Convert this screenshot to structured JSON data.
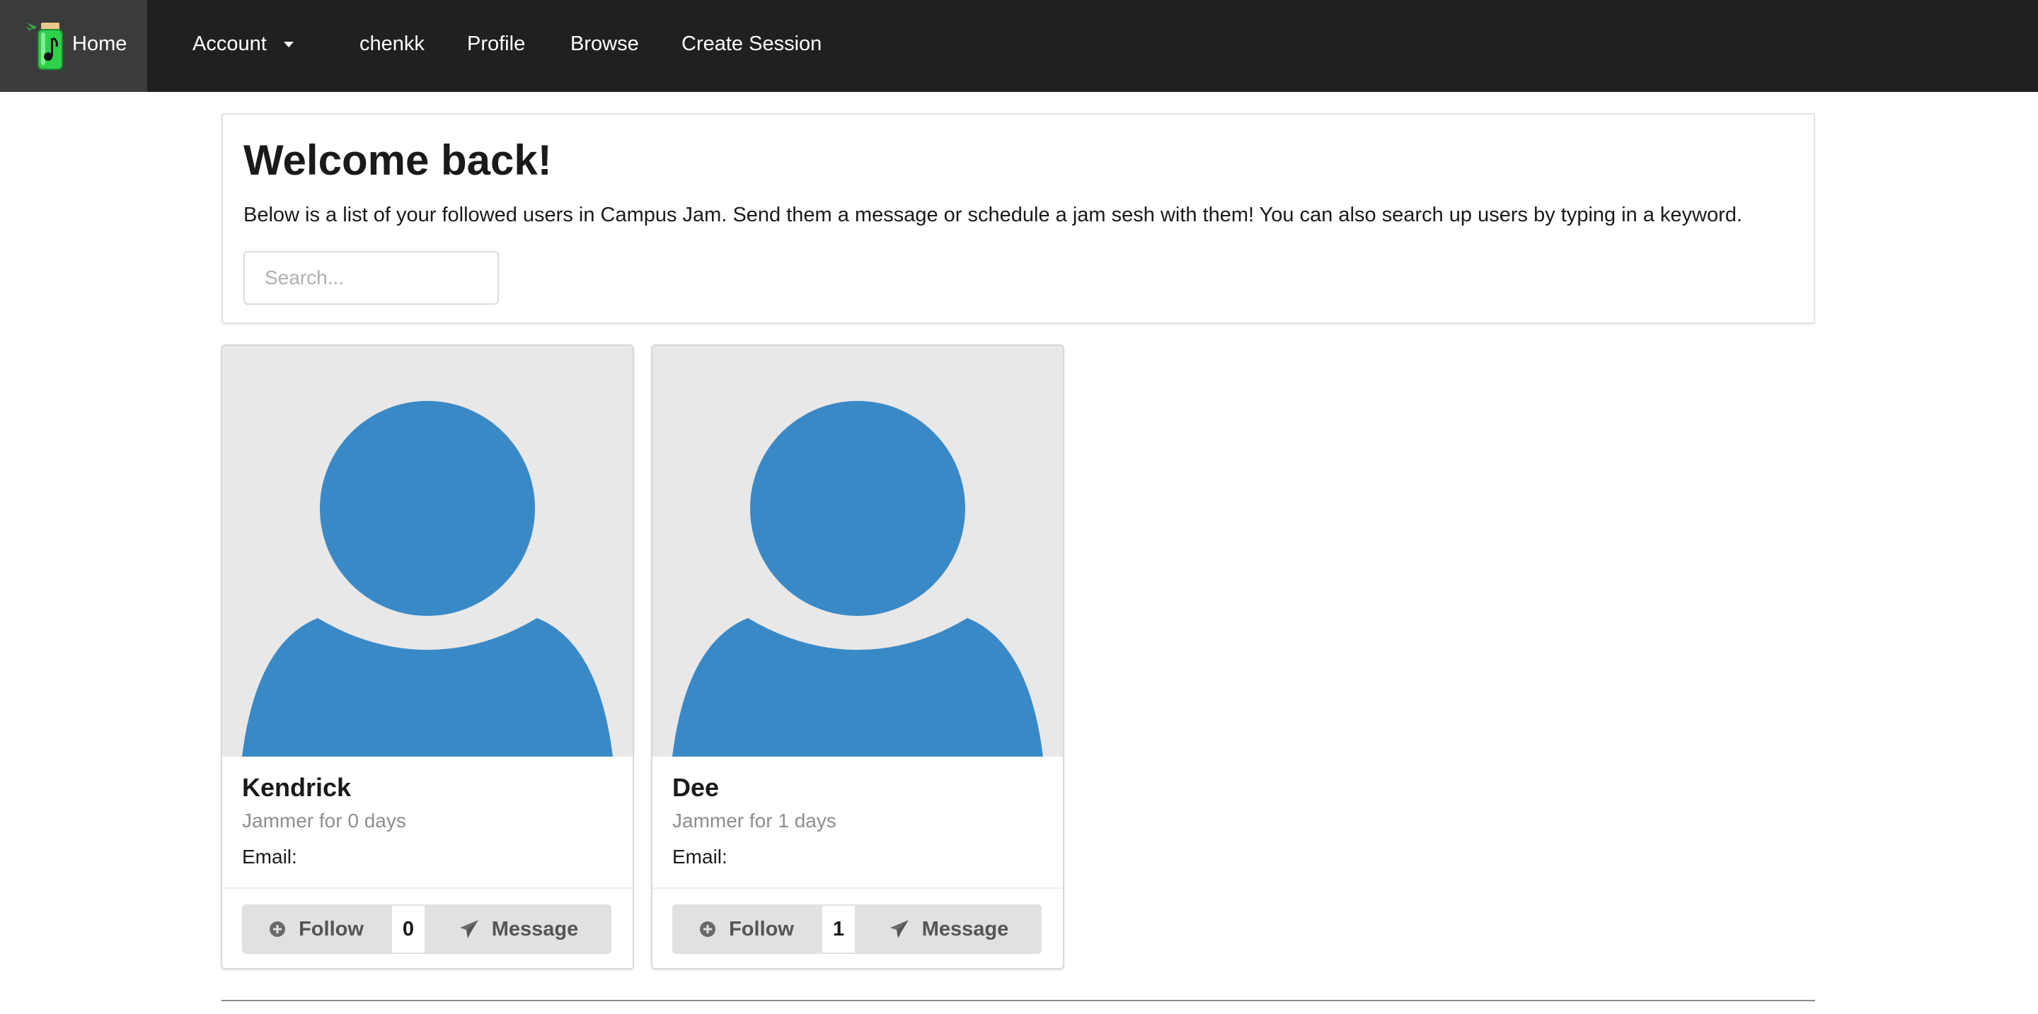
{
  "navbar": {
    "home_label": "Home",
    "account_label": "Account",
    "username": "chenkk",
    "profile_label": "Profile",
    "browse_label": "Browse",
    "create_session_label": "Create Session",
    "bg_color": "#1f2021",
    "home_bg_color": "#3a3b3c"
  },
  "welcome": {
    "title": "Welcome back!",
    "description": "Below is a list of your followed users in Campus Jam. Send them a message or schedule a jam sesh with them! You can also search up users by typing in a keyword.",
    "search_placeholder": "Search..."
  },
  "users": [
    {
      "name": "Kendrick",
      "meta": "Jammer for 0 days",
      "email_label": "Email:",
      "follow_label": "Follow",
      "follow_count": "0",
      "message_label": "Message"
    },
    {
      "name": "Dee",
      "meta": "Jammer for 1 days",
      "email_label": "Email:",
      "follow_label": "Follow",
      "follow_count": "1",
      "message_label": "Message"
    }
  ],
  "icons": {
    "logo": "jar-music-logo-icon",
    "avatar": "user-placeholder-icon",
    "follow": "plus-circle-icon",
    "message": "paper-plane-icon"
  },
  "colors": {
    "avatar_blue": "#3a89c7",
    "avatar_bg": "#e8e8e8",
    "button_bg": "#e0e1e2"
  }
}
